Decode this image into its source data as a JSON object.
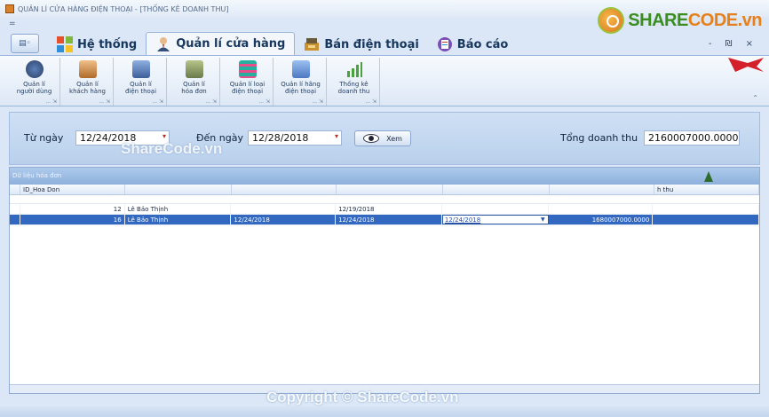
{
  "window": {
    "title": "QUẢN LÍ CỬA HÀNG ĐIỆN THOẠI - [THỐNG KÊ DOANH THU]"
  },
  "logo": {
    "text_main": "SHARE",
    "text_accent": "CODE.vn"
  },
  "qat": {
    "label": "="
  },
  "tabs": [
    {
      "label": "Hệ thống",
      "icon": "windows-icon"
    },
    {
      "label": "Quản lí cửa hàng",
      "icon": "user-icon",
      "active": true
    },
    {
      "label": "Bán điện thoại",
      "icon": "cashier-icon"
    },
    {
      "label": "Báo cáo",
      "icon": "report-icon"
    }
  ],
  "window_controls": {
    "label": "- ₪ ×"
  },
  "ribbon": {
    "items": [
      {
        "label": "Quản lí\nngười dùng",
        "color": "#2c3e64"
      },
      {
        "label": "Quản lí\nkhách hàng",
        "color": "#b06a2a"
      },
      {
        "label": "Quản lí\nđiện thoại",
        "color": "#3d5f9a"
      },
      {
        "label": "Quản lí\nhóa đơn",
        "color": "#6a7a4a"
      },
      {
        "label": "Quản lí loại\nđiện thoại",
        "color": "#27b0a0"
      },
      {
        "label": "Quản lí hãng\nđiện thoại",
        "color": "#4d78c2"
      },
      {
        "label": "Thống kê\ndoanh thu",
        "color": "#4aa33a"
      }
    ],
    "footer": "... ⇲"
  },
  "filter": {
    "from_label": "Từ ngày",
    "from_value": "12/24/2018",
    "to_label": "Đến ngày",
    "to_value": "12/28/2018",
    "view_label": "Xem",
    "total_label": "Tổng doanh thu",
    "total_value": "2160007000.0000"
  },
  "watermark_top": "ShareCode.vn",
  "grid": {
    "caption": "Dữ liệu hóa đơn",
    "columns": [
      "",
      "ID_Hoa Don",
      "",
      "",
      "",
      "",
      "",
      "h thu"
    ],
    "rows": [
      [
        "",
        "12",
        "Lê Bảo Thịnh",
        "",
        "12/19/2018",
        "",
        "",
        ""
      ],
      [
        "",
        "16",
        "Lê Bảo Thịnh",
        "12/24/2018",
        "12/24/2018",
        "12/24/2018",
        "1680007000.0000",
        ""
      ]
    ]
  },
  "watermark_bottom": "Copyright © ShareCode.vn"
}
